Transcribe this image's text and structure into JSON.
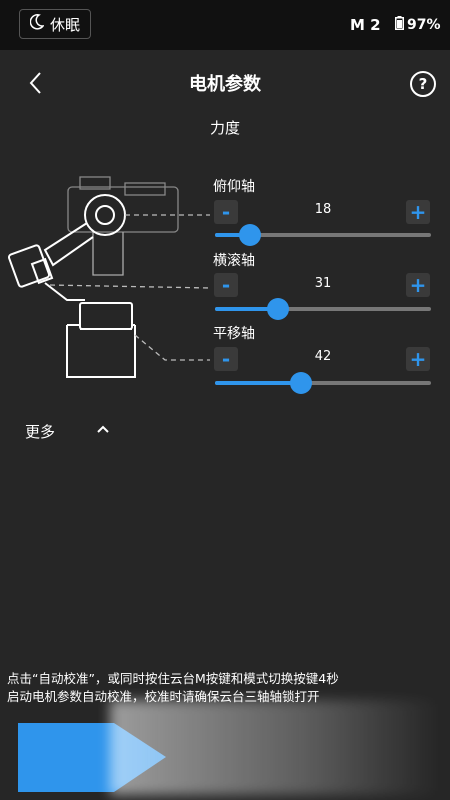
{
  "status_bar": {
    "sleep_label": "休眠",
    "mode": "M 2",
    "battery": "97%"
  },
  "header": {
    "title": "电机参数",
    "help": "?"
  },
  "section": {
    "label": "力度"
  },
  "axes": [
    {
      "label": "俯仰轴",
      "value": "18",
      "level_percent": 16
    },
    {
      "label": "横滚轴",
      "value": "31",
      "level_percent": 29
    },
    {
      "label": "平移轴",
      "value": "42",
      "level_percent": 40
    }
  ],
  "controls": {
    "minus": "-",
    "plus": "+"
  },
  "more": {
    "label": "更多"
  },
  "info": {
    "line1": "点击“自动校准”，或同时按住云台M按键和模式切换按键4秒",
    "line2": "启动电机参数自动校准，校准时请确保云台三轴轴锁打开"
  },
  "colors": {
    "accent": "#2f95ec",
    "background": "#262626",
    "status_bar": "#111111"
  }
}
